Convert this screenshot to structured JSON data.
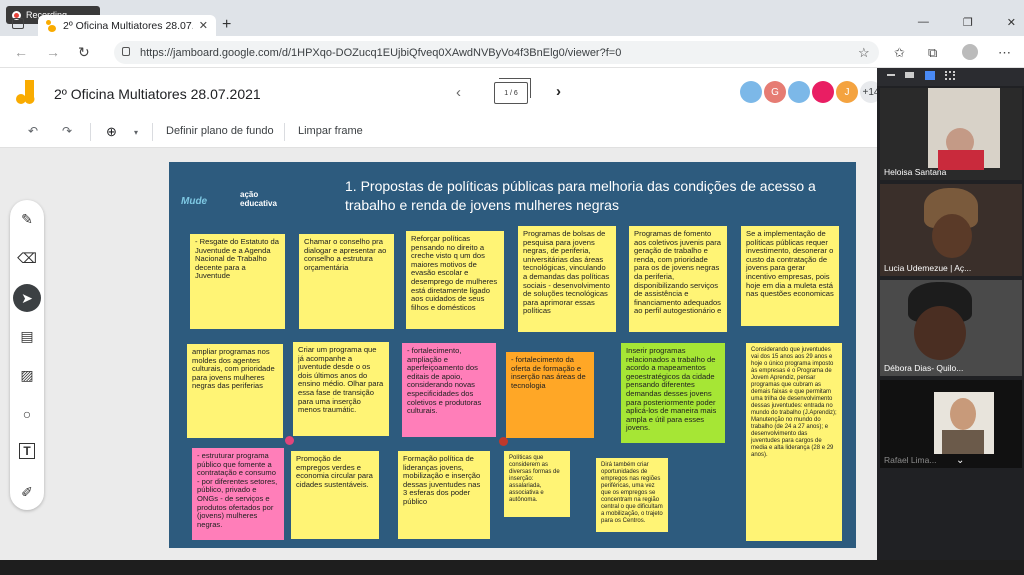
{
  "recording": {
    "label": "Recording..."
  },
  "browser": {
    "tab_title": "2º Oficina Multiatores 28.07.2021",
    "url": "https://jamboard.google.com/d/1HPXqo-DOZucq1EUjbiQfveq0XAwdNVByVo4f3BnElg0/viewer?f=0"
  },
  "jamboard": {
    "title": "2º Oficina Multiatores 28.07.2021",
    "frame_indicator": "1 / 6",
    "extra_participants": "+14",
    "toolbar": {
      "set_background": "Definir plano de fundo",
      "clear_frame": "Limpar frame"
    },
    "avatars": [
      {
        "letter": "",
        "color": "#7cb8e8"
      },
      {
        "letter": "G",
        "color": "#e67c73"
      },
      {
        "letter": "",
        "color": "#7cb8e8"
      },
      {
        "letter": "",
        "color": "#e91e63"
      },
      {
        "letter": "J",
        "color": "#f4a340"
      }
    ]
  },
  "board": {
    "title": "1. Propostas de políticas públicas para melhoria das condições de acesso a trabalho e renda de jovens mulheres negras",
    "logo_left": "Mude",
    "logo_right": "ação educativa",
    "notes": [
      "- Resgate do Estatuto da Juventude e a Agenda Nacional de Trabalho decente para a Juventude",
      "Chamar o conselho pra dialogar e apresentar ao conselho a estrutura orçamentária",
      "Reforçar políticas pensando no direito a creche visto q um dos maiores motivos de evasão escolar e desemprego de mulheres está diretamente ligado aos cuidados de seus filhos e domésticos",
      "Programas de bolsas de pesquisa para jovens negras, de periferia, universitárias das áreas tecnológicas, vinculando a demandas das políticas sociais - desenvolvimento de soluções tecnológicas para aprimorar essas políticas",
      "Programas de fomento aos coletivos juvenis para geração de trabalho e renda, com prioridade para os de jovens negras da periferia, disponibilizando serviços de assistência e financiamento adequados ao perfil autogestionário e",
      "Se a implementação de políticas públicas requer investimento, desonerar o custo da contratação de jovens para gerar incentivo empresas, pois hoje em dia a muleta está nas questões economicas",
      "ampliar programas nos moldes dos agentes culturais, com prioridade para jovens mulheres negras das periferias",
      "Criar um programa que já acompanhe a juventude desde o os dois últimos anos do ensino médio. Olhar para essa fase de transição para uma inserção menos traumátic.",
      "- fortalecimento, ampliação e aperfeiçoamento dos editais de apoio, considerando novas especificidades dos coletivos e produtoras culturais.",
      "- fortalecimento da oferta de formação e inserção nas áreas de tecnologia",
      "Inserir programas relacionados a trabalho de acordo a mapeamentos geoestratégicos da cidade pensando diferentes demandas desses jovens para posteriormente poder aplicá-los de maneira mais ampla e útil para esses jovens.",
      "Considerando que juventudes vai dos 15 anos aos 29 anos e hoje o único programa imposto às empresas é o Programa de Jovem Aprendiz, pensar programas que cubram as demais faixas e que permitam uma trilha de desenvolvimento dessas juventudes: entrada no mundo do trabalho (J.Aprendiz); Manutenção no mundo do trabalho (de 24 a 27 anos); e desenvolvimento das juventudes para cargos de media e alta liderança (28 e 29 anos).",
      "- estruturar programa público que fomente a contratação e consumo - por diferentes setores, público, privado e ONGs - de serviços e produtos ofertados por (jovens) mulheres negras.",
      "Promoção de empregos verdes e economia circular para cidades sustentáveis.",
      "Formação política de lideranças jovens, mobilização e inserção dessas juventudes nas 3 esferas dos poder público",
      "Políticas que considerem as diversas formas de inserção: assalariada, associativa e autônoma.",
      "Dirá também criar oportunidades de empregos nas regiões periféricas, uma vez que os empregos se concentram na região central o que dificultam a mobilização, o trajeto para os Centros."
    ]
  },
  "video_call": {
    "participants": [
      {
        "name": "Heloisa Santana"
      },
      {
        "name": "Lucia Udemezue | Aç..."
      },
      {
        "name": "Débora Dias- Quilo..."
      },
      {
        "name": "Rafael Lima..."
      }
    ]
  }
}
